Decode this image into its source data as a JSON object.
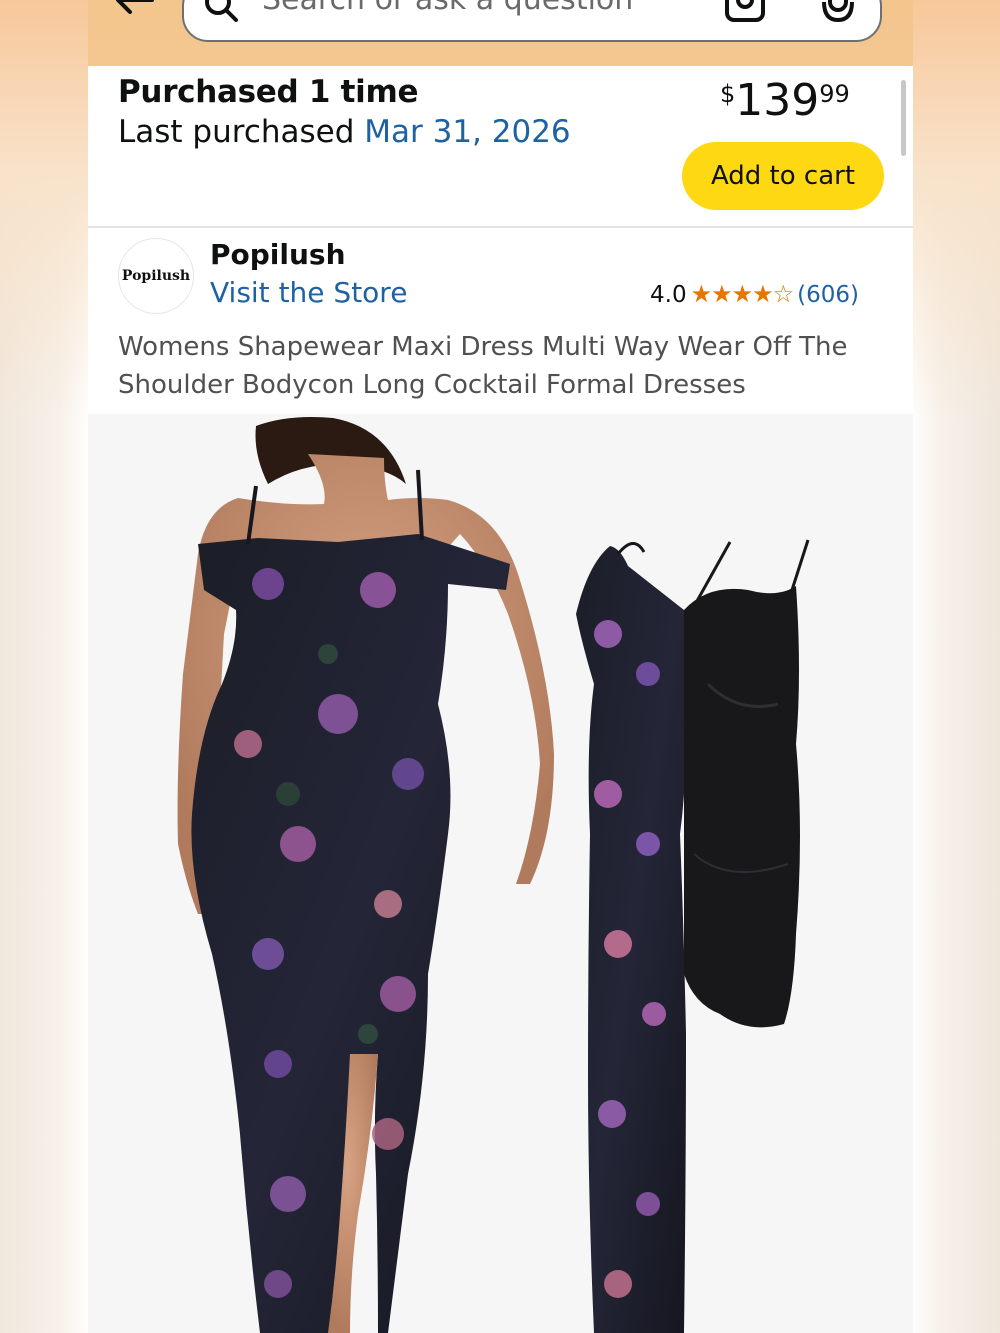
{
  "header": {
    "search_placeholder": "Search or ask a question",
    "icons": [
      "back-arrow-icon",
      "search-icon",
      "camera-icon",
      "mic-icon"
    ]
  },
  "purchase": {
    "title": "Purchased 1 time",
    "last_label": "Last purchased ",
    "last_date": "Mar 31, 2026",
    "price_symbol": "$",
    "price_whole": "139",
    "price_fraction": "99",
    "add_to_cart": "Add to cart"
  },
  "store": {
    "logo_text": "Popilush",
    "name": "Popilush",
    "visit_link": "Visit the Store",
    "rating": "4.0",
    "stars": "★★★★☆",
    "review_count": "(606)"
  },
  "product": {
    "title": "Womens Shapewear Maxi Dress Multi Way Wear Off The Shoulder Bodycon Long Cocktail Formal Dresses"
  },
  "colors": {
    "accent_link": "#1f62a3",
    "add_to_cart_bg": "#ffd814",
    "star": "#e77600",
    "header_bg": "#f3c68e"
  }
}
